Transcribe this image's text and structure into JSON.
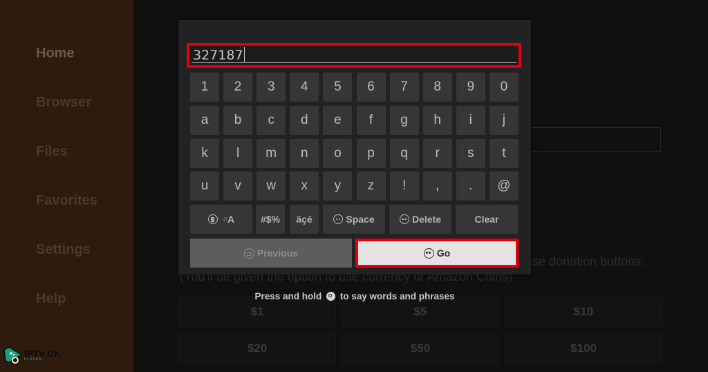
{
  "sidebar": {
    "items": [
      {
        "label": "Home",
        "active": true
      },
      {
        "label": "Browser"
      },
      {
        "label": "Files"
      },
      {
        "label": "Favorites"
      },
      {
        "label": "Settings"
      },
      {
        "label": "Help"
      }
    ],
    "logo": {
      "title": "IPTV UK",
      "subtitle": "PLAYER"
    }
  },
  "background": {
    "donation_text_line1": "ase donation buttons:",
    "donation_text_line2": "(You'll be given the option to use currency or Amazon Coins)",
    "donation_amounts": [
      "$1",
      "$5",
      "$10",
      "$20",
      "$50",
      "$100"
    ]
  },
  "keyboard": {
    "input_value": "327187",
    "number_row": [
      "1",
      "2",
      "3",
      "4",
      "5",
      "6",
      "7",
      "8",
      "9",
      "0"
    ],
    "letter_rows": [
      [
        "a",
        "b",
        "c",
        "d",
        "e",
        "f",
        "g",
        "h",
        "i",
        "j"
      ],
      [
        "k",
        "l",
        "m",
        "n",
        "o",
        "p",
        "q",
        "r",
        "s",
        "t"
      ],
      [
        "u",
        "v",
        "w",
        "x",
        "y",
        "z",
        "!",
        ",",
        ".",
        "@"
      ]
    ],
    "function_row": {
      "case_toggle_faded": "a",
      "case_toggle": "A",
      "symbols": "#$%",
      "accents": "äçé",
      "space": "Space",
      "delete": "Delete",
      "clear": "Clear"
    },
    "previous_label": "Previous",
    "go_label": "Go",
    "highlight_color": "#e3000f"
  },
  "voice_hint": {
    "before": "Press and hold",
    "after": "to say words and phrases"
  }
}
